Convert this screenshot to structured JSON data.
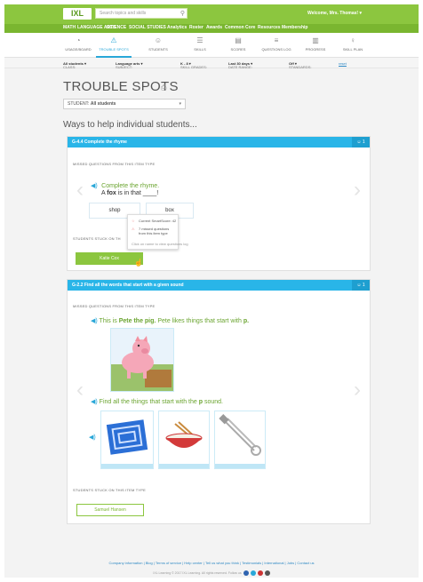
{
  "header": {
    "logo": "IXL",
    "search_placeholder": "Search topics and skills",
    "welcome": "Welcome, Mrs. Thomas! ▾"
  },
  "subnav": [
    "MATH",
    "LANGUAGE ARTS",
    "SCIENCE",
    "SOCIAL STUDIES",
    "Analytics",
    "Roster",
    "Awards",
    "Common Core",
    "Resources",
    "Membership"
  ],
  "toolbar": [
    {
      "icon": "dashboard-icon",
      "label": "USAGE/BOARD"
    },
    {
      "icon": "trouble-spots-icon",
      "label": "TROUBLE SPOTS",
      "active": true
    },
    {
      "icon": "students-icon",
      "label": "STUDENTS"
    },
    {
      "icon": "skills-icon",
      "label": "SKILLS"
    },
    {
      "icon": "scores-icon",
      "label": "SCORES"
    },
    {
      "icon": "questions-log-icon",
      "label": "QUESTIONS LOG"
    },
    {
      "icon": "progress-icon",
      "label": "PROGRESS"
    },
    {
      "icon": "skill-plan-icon",
      "label": "SKILL PLAN"
    }
  ],
  "filters": {
    "class_label": "CLASS:",
    "class_value": "All students ▾",
    "subject_label": "SUBJECT:",
    "subject_value": "Language arts ▾",
    "grade_label": "SKILL GRADES:",
    "grade_value": "K - 8 ▾",
    "date_label": "DATE RANGE:",
    "date_value": "Last 30 days ▾",
    "standards_label": "STANDARDS:",
    "standards_value": "Off ▾",
    "reset": "reset"
  },
  "page_title": "TROUBLE SPOTS",
  "student": {
    "label": "STUDENT:",
    "value": "All students"
  },
  "ways_heading": "Ways to help individual students...",
  "card1": {
    "title": "G-4.4 Complete the rhyme",
    "count": "1",
    "missed_label": "MISSED QUESTIONS FROM THIS ITEM TYPE",
    "prompt": "Complete the rhyme.",
    "sentence_a": "A",
    "sentence_b": "fox",
    "sentence_c": "is in that ____!",
    "choices": [
      "shop",
      "box"
    ],
    "stuck_label": "STUDENTS STUCK ON TH",
    "tooltip": {
      "smartscore": "Current SmartScore: 42",
      "missed_line1": "7 missed questions",
      "missed_line2": "from this item type",
      "hint": "Click on name to view questions log"
    },
    "student_button": "Katie Cox"
  },
  "card2": {
    "title": "G-2.2 Find all the words that start with a given sound",
    "count": "1",
    "missed_label": "MISSED QUESTIONS FROM THIS ITEM TYPE",
    "line1_a": "This is",
    "line1_b": "Pete the pig.",
    "line1_c": "Pete likes things that start with",
    "line1_d": "p.",
    "line2": "Find all the things that start with the",
    "line2_b": "p",
    "line2_c": "sound.",
    "stuck_label": "STUDENTS STUCK ON THIS ITEM TYPE",
    "student_button": "Samuel Hansen"
  },
  "footer": {
    "links": "Company information  |  Blog  |  Terms of service  |  Help center  |  Tell us what you think  |  Testimonials  |  International  |  Jobs  |  Contact us",
    "copy": "IXL Learning  © 2017 IXL Learning. All rights reserved.  Follow us"
  }
}
